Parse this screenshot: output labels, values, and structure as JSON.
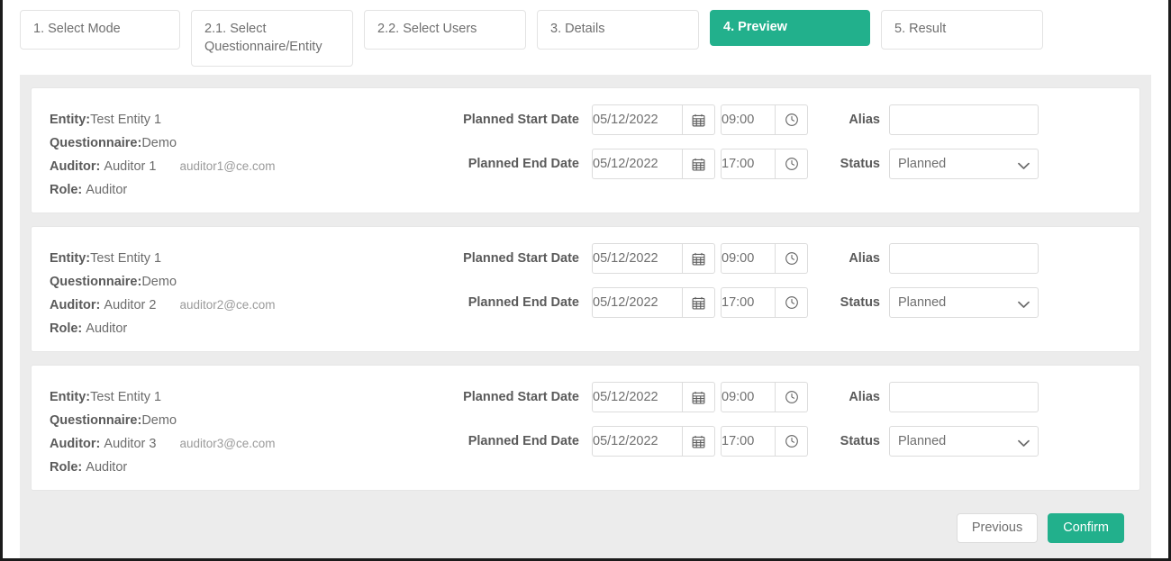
{
  "theme": {
    "accent": "#22b08c",
    "panel_bg": "#ececec",
    "card_bg": "#ffffff",
    "border": "#e3e3e3",
    "text_muted": "#6f6f6f"
  },
  "steps": [
    {
      "label": "1. Select Mode",
      "active": false
    },
    {
      "label": "2.1. Select Questionnaire/Entity",
      "active": false
    },
    {
      "label": "2.2. Select Users",
      "active": false
    },
    {
      "label": "3. Details",
      "active": false
    },
    {
      "label": "4. Preview",
      "active": true
    },
    {
      "label": "5. Result",
      "active": false
    }
  ],
  "labels": {
    "entity": "Entity:",
    "questionnaire": "Questionnaire:",
    "auditor": "Auditor:",
    "role": "Role:",
    "planned_start": "Planned Start Date",
    "planned_end": "Planned End Date",
    "alias": "Alias",
    "status": "Status"
  },
  "cards": [
    {
      "entity": "Test Entity 1",
      "questionnaire": "Demo",
      "auditor": "Auditor 1",
      "email": "auditor1@ce.com",
      "role": "Auditor",
      "start_date": "05/12/2022",
      "start_time": "09:00",
      "end_date": "05/12/2022",
      "end_time": "17:00",
      "alias_value": "",
      "alias_placeholder": "",
      "status": "Planned"
    },
    {
      "entity": "Test Entity 1",
      "questionnaire": "Demo",
      "auditor": "Auditor 2",
      "email": "auditor2@ce.com",
      "role": "Auditor",
      "start_date": "05/12/2022",
      "start_time": "09:00",
      "end_date": "05/12/2022",
      "end_time": "17:00",
      "alias_value": "",
      "alias_placeholder": "",
      "status": "Planned"
    },
    {
      "entity": "Test Entity 1",
      "questionnaire": "Demo",
      "auditor": "Auditor 3",
      "email": "auditor3@ce.com",
      "role": "Auditor",
      "start_date": "05/12/2022",
      "start_time": "09:00",
      "end_date": "05/12/2022",
      "end_time": "17:00",
      "alias_value": "",
      "alias_placeholder": "",
      "status": "Planned"
    }
  ],
  "status_options": [
    "Planned"
  ],
  "icons": {
    "calendar": "calendar-icon",
    "clock": "clock-icon",
    "chevron": "chevron-down-icon"
  },
  "footer": {
    "previous": "Previous",
    "confirm": "Confirm"
  }
}
